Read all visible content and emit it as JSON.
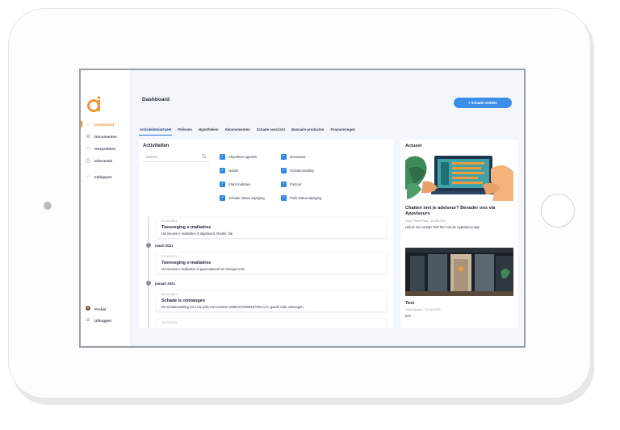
{
  "sidebar": {
    "items": [
      {
        "label": "Dashboard",
        "icon": "home-icon",
        "active": true
      },
      {
        "label": "Documenten",
        "icon": "document-icon"
      },
      {
        "label": "Gesprekken",
        "icon": "chat-icon"
      },
      {
        "label": "Informatie",
        "icon": "info-icon"
      },
      {
        "label": "Inklappen",
        "icon": "chevron-left-icon"
      }
    ],
    "footer": [
      {
        "label": "Profiel",
        "icon": "avatar"
      },
      {
        "label": "Uitloggen",
        "icon": "logout-icon"
      }
    ]
  },
  "header": {
    "title": "Dashboard",
    "primary_button": "+ Schade melden"
  },
  "tabs": [
    {
      "label": "Activiteiten/actueel",
      "active": true
    },
    {
      "label": "Polissen"
    },
    {
      "label": "Hypotheken"
    },
    {
      "label": "Abonnementen"
    },
    {
      "label": "Schade overzicht"
    },
    {
      "label": "Bancaire producten"
    },
    {
      "label": "Financieringen"
    }
  ],
  "activities": {
    "title": "Activiteiten",
    "search_placeholder": "Zoeken",
    "filters": [
      {
        "label": "Afspraken agenda",
        "checked": true
      },
      {
        "label": "Document",
        "checked": true
      },
      {
        "label": "Notitie",
        "checked": true
      },
      {
        "label": "Schademelding",
        "checked": true
      },
      {
        "label": "Klant mutaties",
        "checked": true
      },
      {
        "label": "Factuur",
        "checked": true
      },
      {
        "label": "Schade status wijziging",
        "checked": true
      },
      {
        "label": "Polis status wijziging",
        "checked": true
      }
    ],
    "entries": [
      {
        "date": "01-03-2021",
        "title": "Toevoeging e-mailadres",
        "description": "Uw nieuwe e-mailadres is afgekeurd. Reden: bla"
      },
      {
        "date": "17-03-2021",
        "title": "Toevoeging e-mailadres",
        "description": "Uw nieuwe e-mailadres is geaccepteerd en doorgevoerd."
      },
      {
        "date": "05-03-2021",
        "title": "Schade is ontvangen",
        "description": "De schademelding voor uw polis met nummer 2080157/2568157/001 is in goede orde ontvangen."
      },
      {
        "date": "16-03-2021"
      }
    ],
    "months": [
      "maart 2021",
      "januari 2021"
    ]
  },
  "news": {
    "title": "Actueel",
    "items": [
      {
        "title": "Chatten met je adviseur? Benader ons via Appviseurs",
        "meta": "Door Pieter Pauj - 30-03-2021",
        "description": "Heb je een vraag? Stel hem via de Appviseurs app"
      },
      {
        "title": "Test",
        "meta": "Door Jeroen - 20-04-2020",
        "description": "test"
      }
    ]
  },
  "colors": {
    "accent": "#f0963a",
    "primary": "#3d8ee8",
    "checkbox": "#2f86e0"
  }
}
